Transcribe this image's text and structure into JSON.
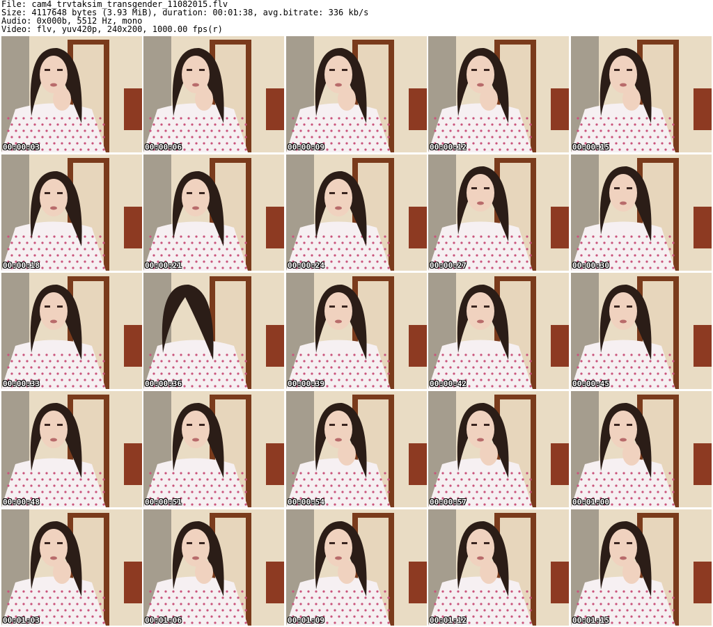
{
  "header": {
    "file": "File: cam4_trvtaksim_transgender_11082015.flv",
    "size": "Size: 4117648 bytes (3.93 MiB), duration: 00:01:38, avg.bitrate: 336 kb/s",
    "audio": "Audio: 0x000b, 5512 Hz, mono",
    "video": "Video: flv, yuv420p, 240x200, 1000.00 fps(r)"
  },
  "thumbnails": [
    {
      "time": "00:00:03",
      "pose": "hand"
    },
    {
      "time": "00:00:06",
      "pose": "hand"
    },
    {
      "time": "00:00:09",
      "pose": "hand"
    },
    {
      "time": "00:00:12",
      "pose": "hand"
    },
    {
      "time": "00:00:15",
      "pose": "hand"
    },
    {
      "time": "00:00:18",
      "pose": "down"
    },
    {
      "time": "00:00:21",
      "pose": "down"
    },
    {
      "time": "00:00:24",
      "pose": "down"
    },
    {
      "time": "00:00:27",
      "pose": "front"
    },
    {
      "time": "00:00:30",
      "pose": "front"
    },
    {
      "time": "00:00:33",
      "pose": "front"
    },
    {
      "time": "00:00:36",
      "pose": "hair"
    },
    {
      "time": "00:00:39",
      "pose": "front"
    },
    {
      "time": "00:00:42",
      "pose": "front"
    },
    {
      "time": "00:00:45",
      "pose": "front"
    },
    {
      "time": "00:00:48",
      "pose": "front"
    },
    {
      "time": "00:00:51",
      "pose": "front"
    },
    {
      "time": "00:00:54",
      "pose": "hand"
    },
    {
      "time": "00:00:57",
      "pose": "hand"
    },
    {
      "time": "00:01:00",
      "pose": "hand"
    },
    {
      "time": "00:01:03",
      "pose": "hand"
    },
    {
      "time": "00:01:06",
      "pose": "hand"
    },
    {
      "time": "00:01:09",
      "pose": "hand"
    },
    {
      "time": "00:01:12",
      "pose": "hand"
    },
    {
      "time": "00:01:15",
      "pose": "hand"
    }
  ],
  "colors": {
    "wall": "#e9dcc4",
    "door": "#7a3b1c",
    "hair": "#2b1d17",
    "skin": "#f0d2bf",
    "shirt": "#f6f0f2",
    "pattern": "#c9547c"
  }
}
